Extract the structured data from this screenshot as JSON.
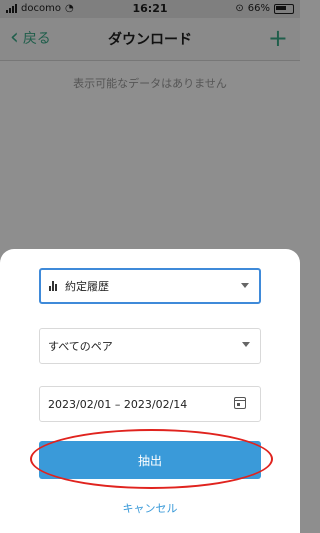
{
  "status_bar": {
    "carrier": "docomo",
    "time": "16:21",
    "battery": "66%"
  },
  "nav": {
    "back_label": "戻る",
    "title": "ダウンロード",
    "add_label": "+"
  },
  "main": {
    "empty_message": "表示可能なデータはありません"
  },
  "sheet": {
    "type_select": "約定履歴",
    "pair_select": "すべてのペア",
    "date_range": "2023/02/01 – 2023/02/14",
    "extract_label": "抽出",
    "cancel_label": "キャンセル"
  }
}
